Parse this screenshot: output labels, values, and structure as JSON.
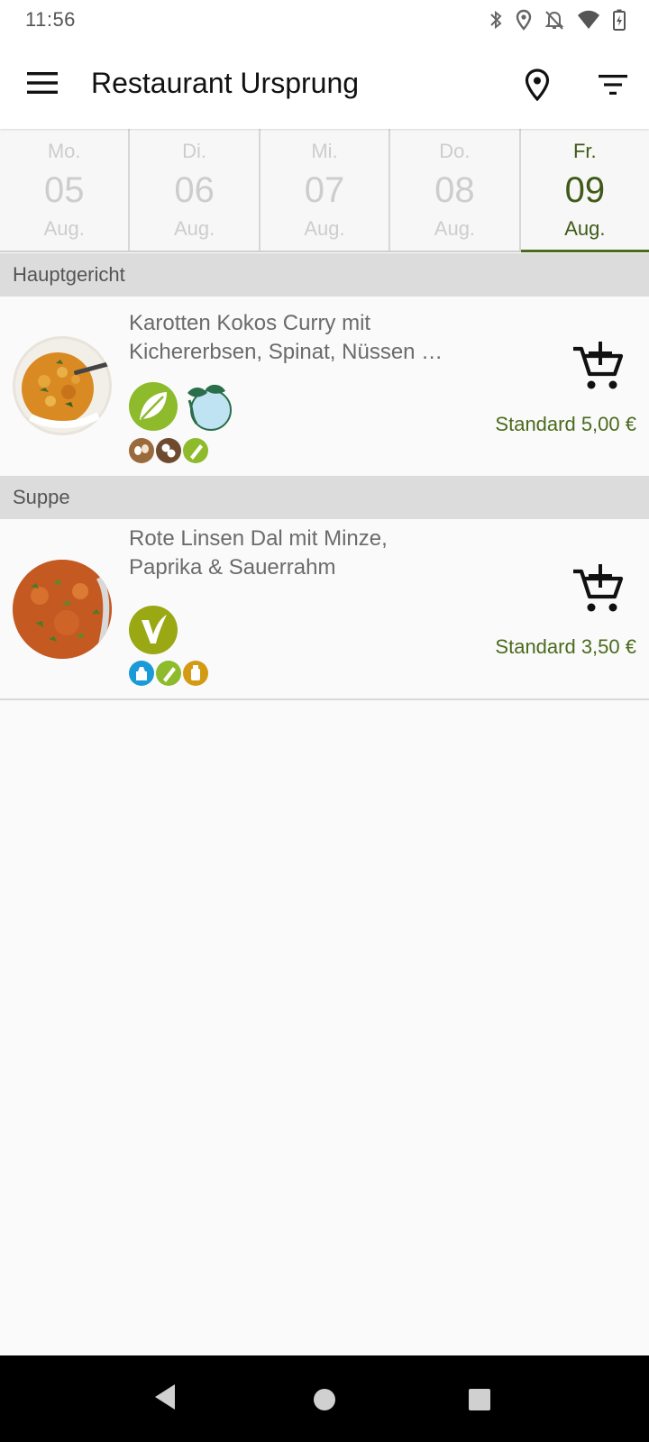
{
  "status_bar": {
    "time": "11:56",
    "icons": [
      "bluetooth-icon",
      "location-icon",
      "notifications-off-icon",
      "wifi-icon",
      "battery-charging-icon"
    ]
  },
  "app_bar": {
    "title": "Restaurant Ursprung",
    "icons": [
      "menu-icon",
      "location-pin-icon",
      "filter-icon"
    ]
  },
  "date_tabs": [
    {
      "dow": "Mo.",
      "day": "05",
      "month": "Aug.",
      "active": false
    },
    {
      "dow": "Di.",
      "day": "06",
      "month": "Aug.",
      "active": false
    },
    {
      "dow": "Mi.",
      "day": "07",
      "month": "Aug.",
      "active": false
    },
    {
      "dow": "Do.",
      "day": "08",
      "month": "Aug.",
      "active": false
    },
    {
      "dow": "Fr.",
      "day": "09",
      "month": "Aug.",
      "active": true
    }
  ],
  "sections": [
    {
      "title": "Hauptgericht",
      "meal": {
        "name_line1": "Karotten Kokos Curry mit",
        "name_line2": "Kichererbsen, Spinat, Nüssen …",
        "badges": [
          "vegetarian-leaf-icon",
          "climate-friendly-icon"
        ],
        "allergens": [
          "nuts-icon",
          "peanut-icon",
          "celery-icon"
        ],
        "price": "Standard 5,00 €"
      }
    },
    {
      "title": "Suppe",
      "meal": {
        "name_line1": "Rote Linsen Dal mit Minze,",
        "name_line2": "Paprika & Sauerrahm",
        "badges": [
          "vegan-icon"
        ],
        "allergens": [
          "milk-icon",
          "celery-icon",
          "mustard-icon"
        ],
        "price": "Standard 3,50 €"
      }
    }
  ],
  "colors": {
    "accent": "#4b6a1c",
    "inactive_tab_text": "#cdcdcd",
    "section_header_bg": "#dcdcdc"
  },
  "nav_bar": {
    "icons": [
      "back-icon",
      "home-icon",
      "recents-icon"
    ]
  }
}
